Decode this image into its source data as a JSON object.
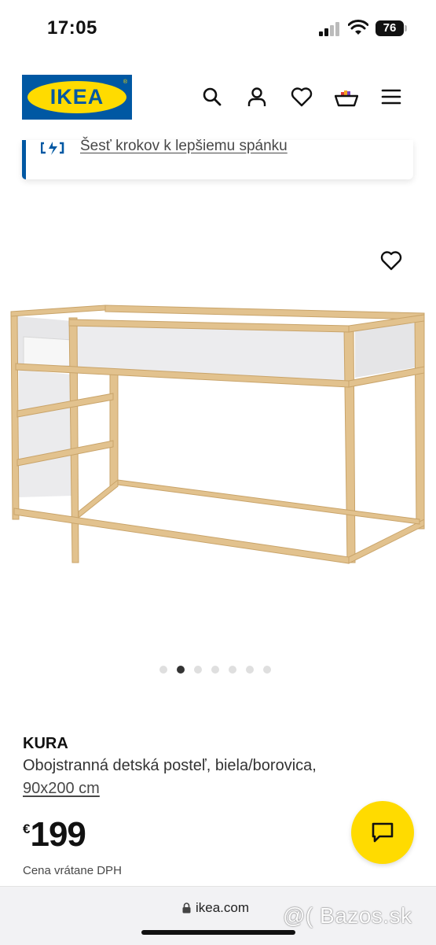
{
  "status_bar": {
    "time": "17:05",
    "battery": "76"
  },
  "header": {
    "brand": "IKEA",
    "icons": [
      "search-icon",
      "account-icon",
      "heart-icon",
      "basket-icon",
      "menu-icon"
    ]
  },
  "banner": {
    "link_text": "Šesť krokov k lepšiemu spánku",
    "icon": "sleep-icon"
  },
  "gallery": {
    "image_count": 7,
    "active_index": 1
  },
  "product": {
    "name": "KURA",
    "description": "Obojstranná detská posteľ, biela/borovica,",
    "size": "90x200 cm",
    "currency": "€",
    "price": "199",
    "price_note": "Cena vrátane DPH"
  },
  "browser": {
    "url": "ikea.com"
  },
  "watermark": "@( Bazos.sk",
  "colors": {
    "ikea_blue": "#0058a3",
    "ikea_yellow": "#ffdb00",
    "pine": "#e2c28e"
  }
}
